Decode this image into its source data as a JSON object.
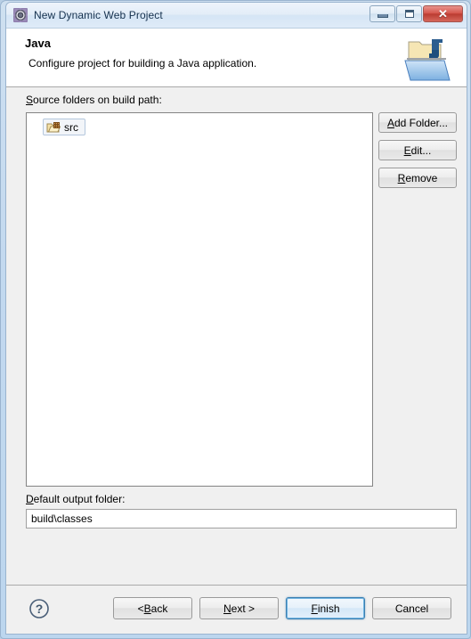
{
  "window": {
    "title": "New Dynamic Web Project",
    "icon": "wizard-gear-icon",
    "controls": {
      "minimize": "minimize-icon",
      "maximize": "maximize-icon",
      "close": "✕"
    }
  },
  "header": {
    "title": "Java",
    "description": "Configure project for building a Java application.",
    "banner_icon": "java-project-folder-icon"
  },
  "main": {
    "source_folders_label_prefix": "S",
    "source_folders_label_rest": "ource folders on build path:",
    "source_folders": [
      {
        "name": "src",
        "icon": "source-package-folder-icon",
        "selected": true
      }
    ],
    "side_buttons": [
      {
        "id": "add-folder",
        "mnemonic": "A",
        "rest": "dd Folder...",
        "prefix": ""
      },
      {
        "id": "edit",
        "mnemonic": "E",
        "rest": "dit...",
        "prefix": ""
      },
      {
        "id": "remove",
        "mnemonic": "R",
        "rest": "emove",
        "prefix": ""
      }
    ],
    "output_label_prefix": "D",
    "output_label_rest": "efault output folder:",
    "output_value": "build\\classes",
    "output_placeholder": "build\\classes"
  },
  "footer": {
    "help_icon": "?",
    "buttons": [
      {
        "id": "back",
        "prefix": "< ",
        "mnemonic": "B",
        "rest": "ack",
        "default": false
      },
      {
        "id": "next",
        "prefix": "",
        "mnemonic": "N",
        "rest": "ext >",
        "default": false
      },
      {
        "id": "finish",
        "prefix": "",
        "mnemonic": "F",
        "rest": "inish",
        "default": true
      },
      {
        "id": "cancel",
        "prefix": "",
        "mnemonic": "",
        "rest": "Cancel",
        "default": false
      }
    ]
  },
  "colors": {
    "frame": "#bcd6ee",
    "dialog_bg": "#f0f0f0",
    "header_bg": "#ffffff",
    "default_button_border": "#3c7fb1",
    "close_button": "#d4544a",
    "selection_border": "#b4c7dd"
  }
}
